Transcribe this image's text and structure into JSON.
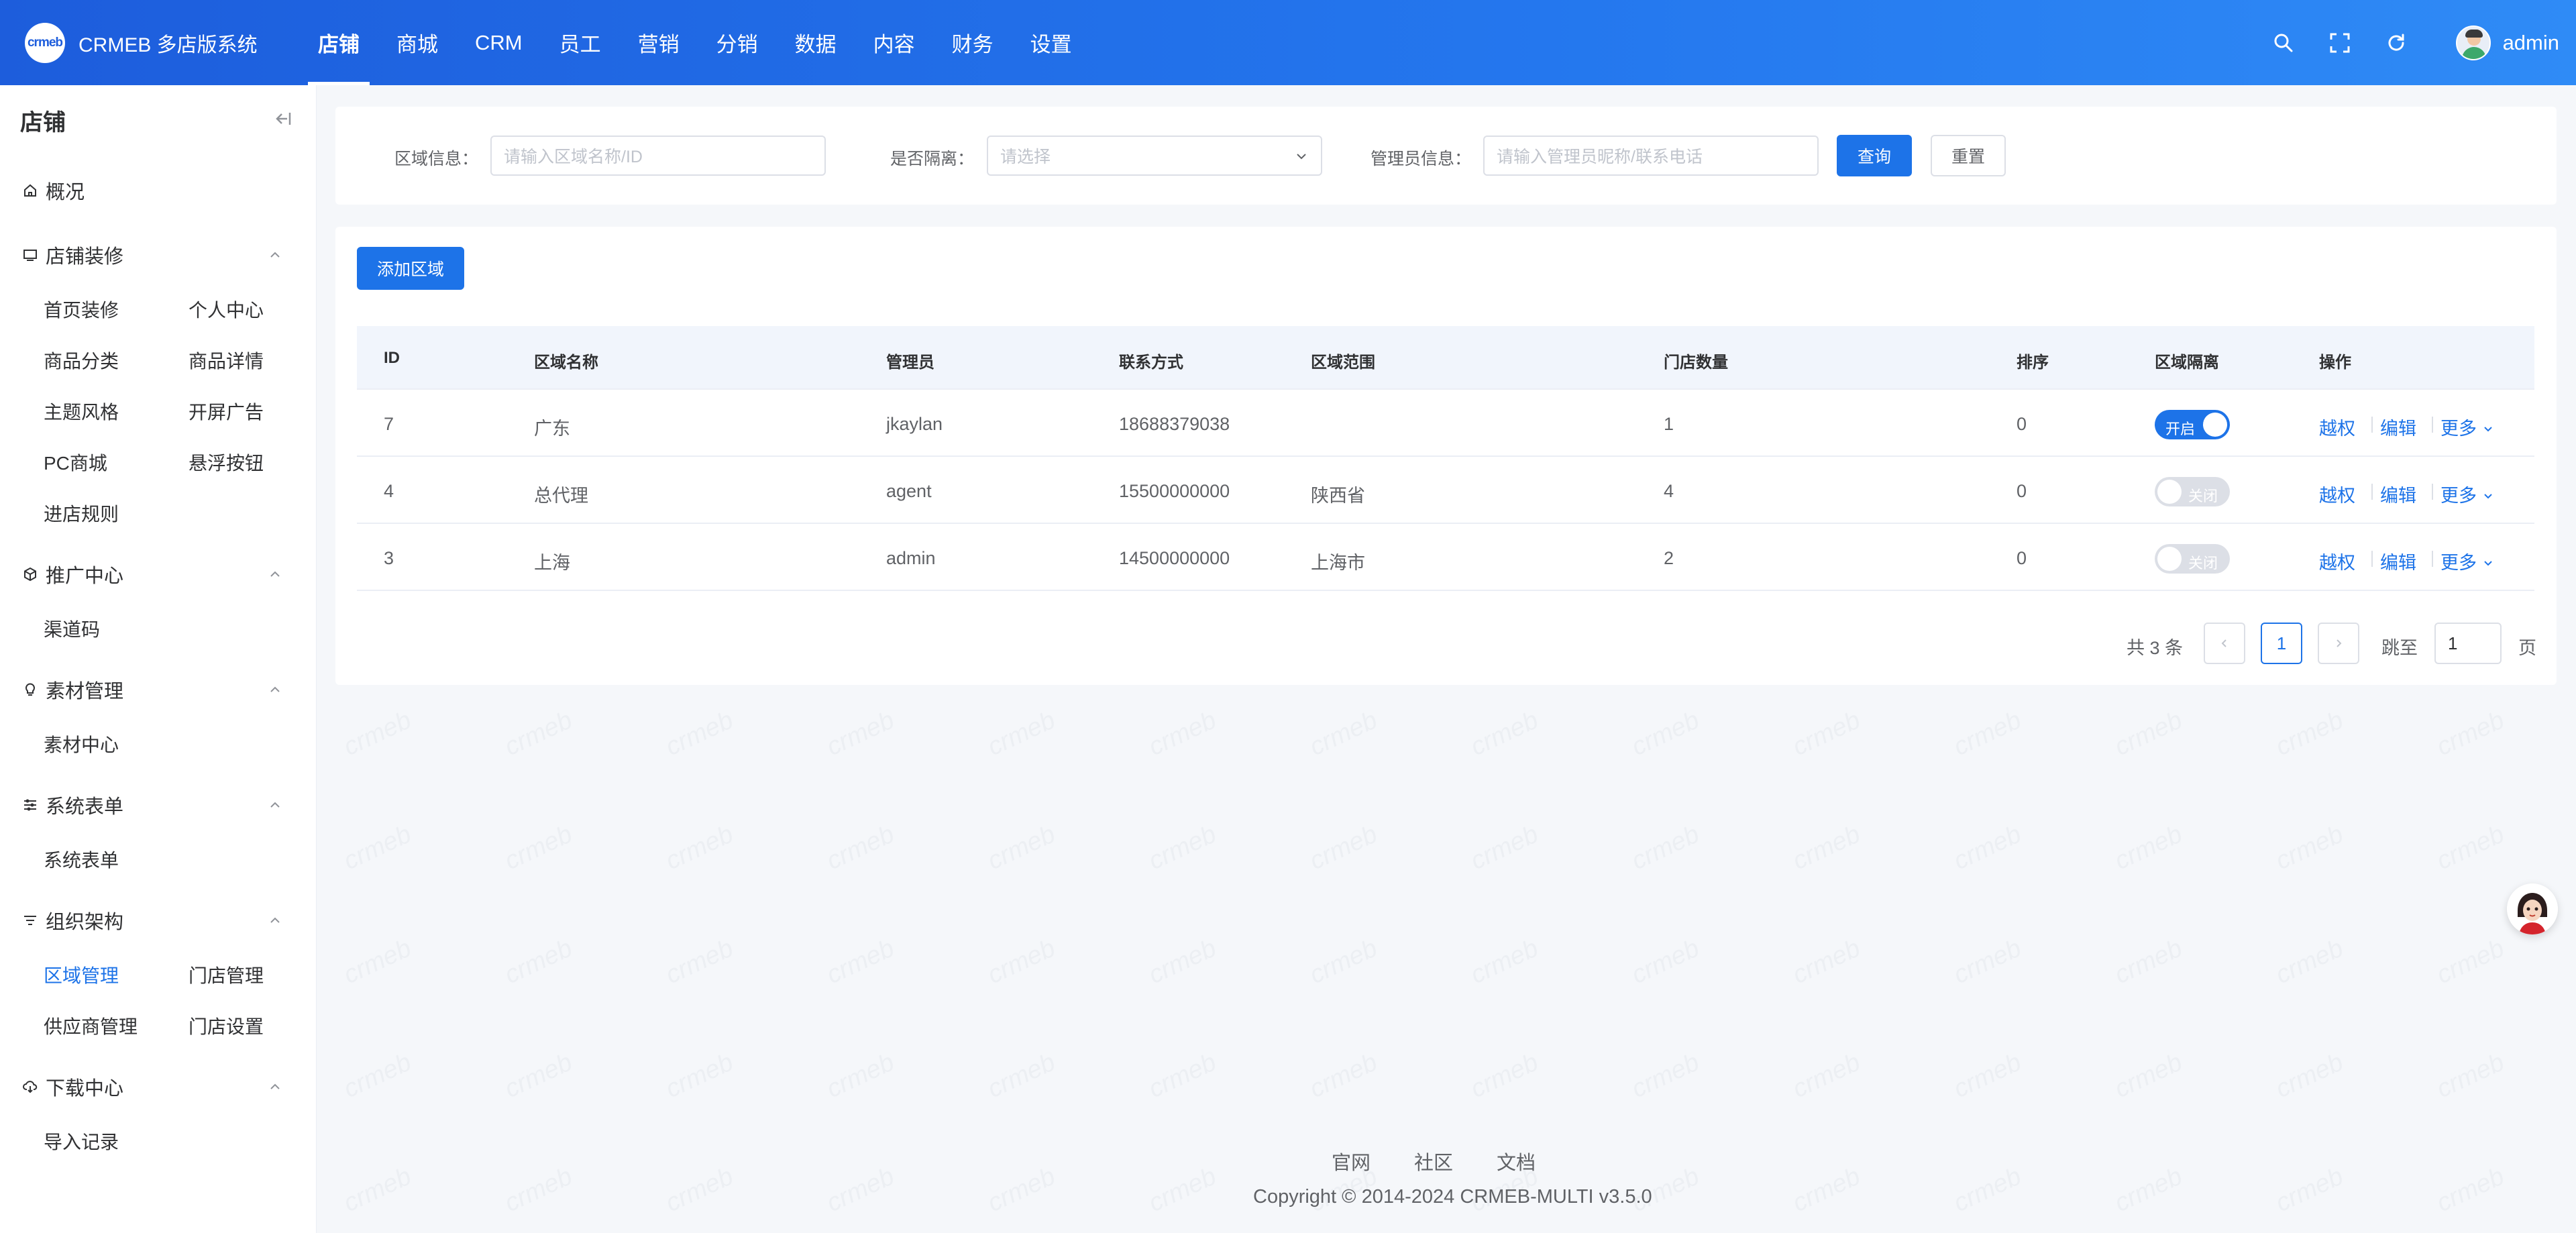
{
  "app": {
    "logo_text": "crmeb",
    "name": "CRMEB 多店版系统"
  },
  "topnav": [
    "店铺",
    "商城",
    "CRM",
    "员工",
    "营销",
    "分销",
    "数据",
    "内容",
    "财务",
    "设置"
  ],
  "user": {
    "name": "admin"
  },
  "sidebar": {
    "title": "店铺",
    "overview": "概况",
    "groups": {
      "decoration": {
        "label": "店铺装修",
        "items": [
          "首页装修",
          "个人中心",
          "商品分类",
          "商品详情",
          "主题风格",
          "开屏广告",
          "PC商城",
          "悬浮按钮",
          "进店规则"
        ]
      },
      "promotion": {
        "label": "推广中心",
        "items": [
          "渠道码"
        ]
      },
      "material": {
        "label": "素材管理",
        "items": [
          "素材中心"
        ]
      },
      "forms": {
        "label": "系统表单",
        "items": [
          "系统表单"
        ]
      },
      "org": {
        "label": "组织架构",
        "items": [
          "区域管理",
          "门店管理",
          "供应商管理",
          "门店设置"
        ],
        "active": "区域管理"
      },
      "download": {
        "label": "下载中心",
        "items": [
          "导入记录"
        ]
      }
    }
  },
  "filters": {
    "region_label": "区域信息：",
    "region_placeholder": "请输入区域名称/ID",
    "isolation_label": "是否隔离：",
    "isolation_placeholder": "请选择",
    "manager_label": "管理员信息：",
    "manager_placeholder": "请输入管理员昵称/联系电话",
    "query_btn": "查询",
    "reset_btn": "重置"
  },
  "add_btn": "添加区域",
  "table": {
    "headers": [
      "ID",
      "区域名称",
      "管理员",
      "联系方式",
      "区域范围",
      "门店数量",
      "排序",
      "区域隔离",
      "操作"
    ],
    "rows": [
      {
        "id": "7",
        "name": "广东",
        "manager": "jkaylan",
        "phone": "18688379038",
        "range": "",
        "stores": "1",
        "sort": "0",
        "isolation": "开启",
        "isolation_on": true
      },
      {
        "id": "4",
        "name": "总代理",
        "manager": "agent",
        "phone": "15500000000",
        "range": "陕西省",
        "stores": "4",
        "sort": "0",
        "isolation": "关闭",
        "isolation_on": false
      },
      {
        "id": "3",
        "name": "上海",
        "manager": "admin",
        "phone": "14500000000",
        "range": "上海市",
        "stores": "2",
        "sort": "0",
        "isolation": "关闭",
        "isolation_on": false
      }
    ],
    "ops": {
      "auth": "越权",
      "edit": "编辑",
      "more": "更多"
    }
  },
  "pagination": {
    "total": "共 3 条",
    "current": "1",
    "jump_label": "跳至",
    "jump_value": "1",
    "page_unit": "页"
  },
  "footer": {
    "links": [
      "官网",
      "社区",
      "文档"
    ],
    "copyright": "Copyright © 2014-2024 CRMEB-MULTI v3.5.0"
  },
  "colors": {
    "primary": "#1d73e8",
    "header_start": "#1d5ddc",
    "header_end": "#2f8bf6",
    "bg": "#f5f7fa"
  },
  "icons": [
    "search-icon",
    "fullscreen-icon",
    "refresh-icon",
    "collapse-icon",
    "home-icon",
    "monitor-icon",
    "cube-icon",
    "bulb-icon",
    "form-icon",
    "filter-icon",
    "cloud-download-icon",
    "chevron-down-icon",
    "chevron-left-icon",
    "chevron-right-icon"
  ]
}
